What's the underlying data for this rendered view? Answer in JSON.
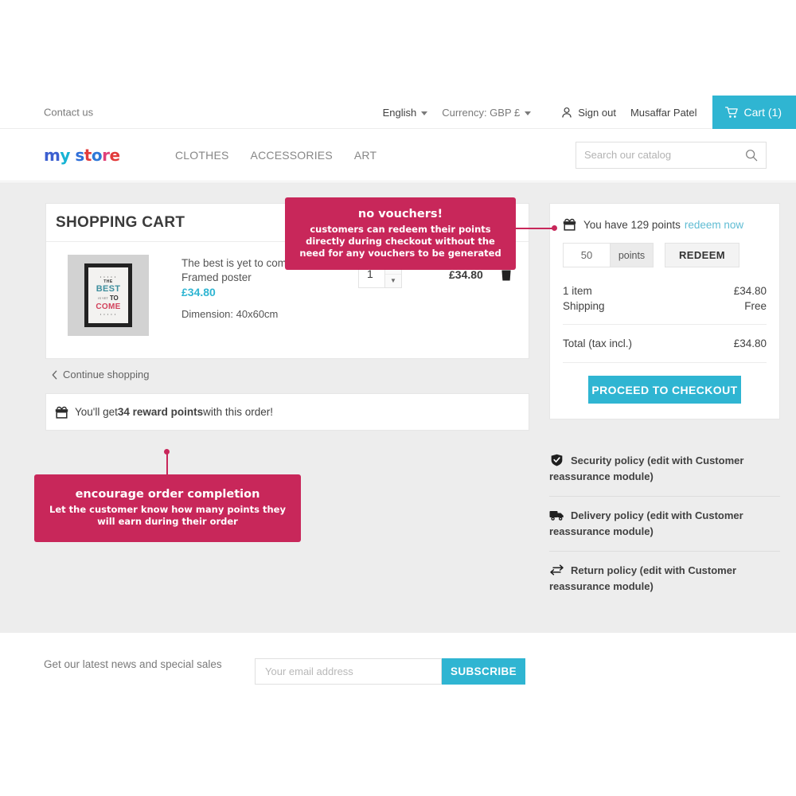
{
  "header": {
    "contact_label": "Contact us",
    "language": "English",
    "currency": "Currency: GBP £",
    "sign_out": "Sign out",
    "user_name": "Musaffar Patel",
    "cart_label": "Cart (1)",
    "logo": {
      "part1": "my",
      "part2": "store"
    },
    "menu": [
      "CLOTHES",
      "ACCESSORIES",
      "ART"
    ],
    "search_placeholder": "Search our catalog",
    "search_value": ""
  },
  "cart": {
    "title": "SHOPPING CART",
    "product": {
      "name": "The best is yet to come'",
      "subtitle": "Framed poster",
      "price": "£34.80",
      "dimension": "Dimension: 40x60cm",
      "quantity": "1",
      "line_total": "£34.80",
      "poster_text": {
        "the": "THE",
        "best": "BEST",
        "is_yet": "IS YET",
        "to": "TO",
        "come": "COME"
      }
    },
    "continue_shopping": "Continue shopping",
    "reward_notice_pre": "You'll get ",
    "reward_notice_bold": "34 reward points",
    "reward_notice_post": " with this order!"
  },
  "summary": {
    "points_text": "You have 129 points",
    "redeem_link": "redeem now",
    "redeem_value": "50",
    "redeem_unit": "points",
    "redeem_button": "REDEEM",
    "lines": [
      {
        "label": "1 item",
        "value": "£34.80"
      },
      {
        "label": "Shipping",
        "value": "Free"
      }
    ],
    "total_label": "Total (tax incl.)",
    "total_value": "£34.80",
    "checkout_button": "PROCEED TO CHECKOUT"
  },
  "policies": [
    {
      "icon": "shield-icon",
      "text": "Security policy (edit with Customer reassurance module)"
    },
    {
      "icon": "truck-icon",
      "text": "Delivery policy (edit with Customer reassurance module)"
    },
    {
      "icon": "exchange-icon",
      "text": "Return policy (edit with Customer reassurance module)"
    }
  ],
  "callouts": {
    "vouchers": {
      "title": "no vouchers!",
      "body": "customers can redeem their points directly during checkout without the need for any vouchers to be generated"
    },
    "encourage": {
      "title": "encourage order completion",
      "body": "Let the customer know how many points they will earn during their order"
    }
  },
  "footer": {
    "newsletter_text": "Get our latest news and special sales",
    "email_placeholder": "Your email address",
    "email_value": "",
    "subscribe_button": "SUBSCRIBE"
  },
  "colors": {
    "accent_teal": "#2fb5d2",
    "callout_pink": "#c8275a",
    "page_bg": "#ededed"
  }
}
